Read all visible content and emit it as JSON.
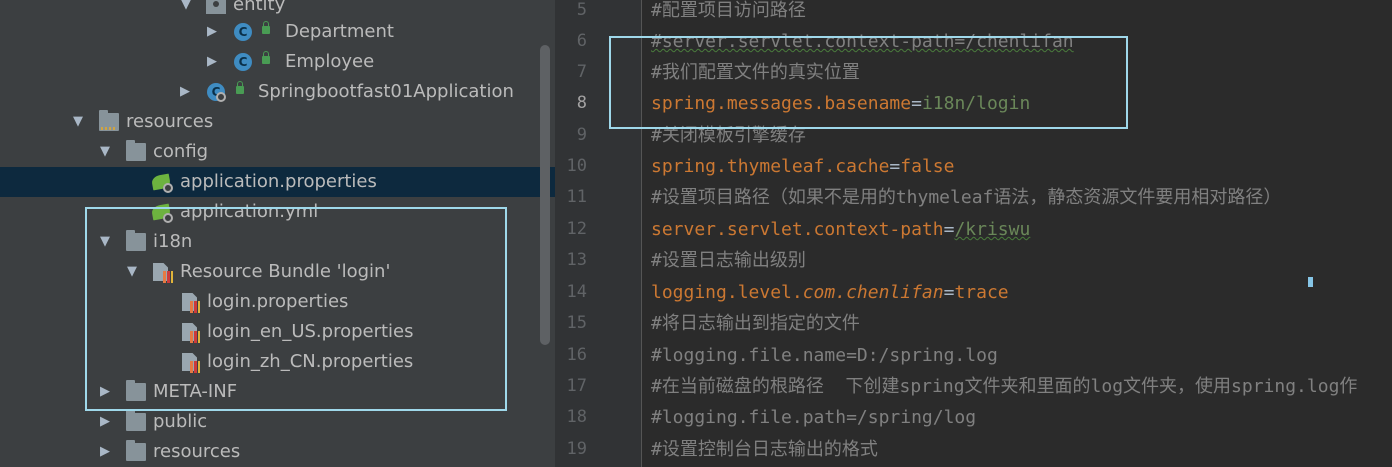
{
  "tree": {
    "rows": [
      {
        "label": "entity"
      },
      {
        "label": "Department",
        "icon": "class-c-icon"
      },
      {
        "label": "Employee",
        "icon": "class-c-icon"
      },
      {
        "label": "Springbootfast01Application",
        "icon": "spring-boot-app-icon"
      },
      {
        "label": "resources"
      },
      {
        "label": "config"
      },
      {
        "label": "application.properties",
        "selected": true
      },
      {
        "label": "application.yml"
      },
      {
        "label": "i18n"
      },
      {
        "label": "Resource Bundle 'login'"
      },
      {
        "label": "login.properties"
      },
      {
        "label": "login_en_US.properties"
      },
      {
        "label": "login_zh_CN.properties"
      },
      {
        "label": "META-INF"
      },
      {
        "label": "public"
      },
      {
        "label": "resources"
      }
    ]
  },
  "editor": {
    "current_line": "8",
    "lines": [
      {
        "num": "5",
        "text": "#配置项目访问路径"
      },
      {
        "num": "6",
        "text": "#server.servlet.context-path=/chenlifan"
      },
      {
        "num": "7",
        "text": "#我们配置文件的真实位置"
      },
      {
        "num": "8",
        "key": "spring.messages.basename",
        "eq": "=",
        "value": "i18n/login"
      },
      {
        "num": "9",
        "text": "#关闭模板引擎缓存"
      },
      {
        "num": "10",
        "key": "spring.thymeleaf.cache",
        "eq": "=",
        "value": "false"
      },
      {
        "num": "11",
        "text": "#设置项目路径（如果不是用的thymeleaf语法，静态资源文件要用相对路径）"
      },
      {
        "num": "12",
        "key": "server.servlet.context-path",
        "eq": "=",
        "value": "/kriswu"
      },
      {
        "num": "13",
        "text": "#设置日志输出级别"
      },
      {
        "num": "14",
        "key": "logging.level.",
        "key_italic": "com.chenlifan",
        "eq": "=",
        "value": "trace"
      },
      {
        "num": "15",
        "text": "#将日志输出到指定的文件"
      },
      {
        "num": "16",
        "text": "#logging.file.name=D:/spring.log"
      },
      {
        "num": "17",
        "text": "#在当前磁盘的根路径  下创建spring文件夹和里面的log文件夹，使用spring.log作"
      },
      {
        "num": "18",
        "text": "#logging.file.path=/spring/log"
      },
      {
        "num": "19",
        "text": "#设置控制台日志输出的格式"
      }
    ]
  },
  "colors": {
    "tree_bg": "#3c3f41",
    "editor_bg": "#2b2b2b",
    "selection": "#0d293e",
    "highlight_box": "#9fd8ea",
    "comment": "#808080",
    "key": "#cc7832",
    "value": "#6a8759"
  }
}
